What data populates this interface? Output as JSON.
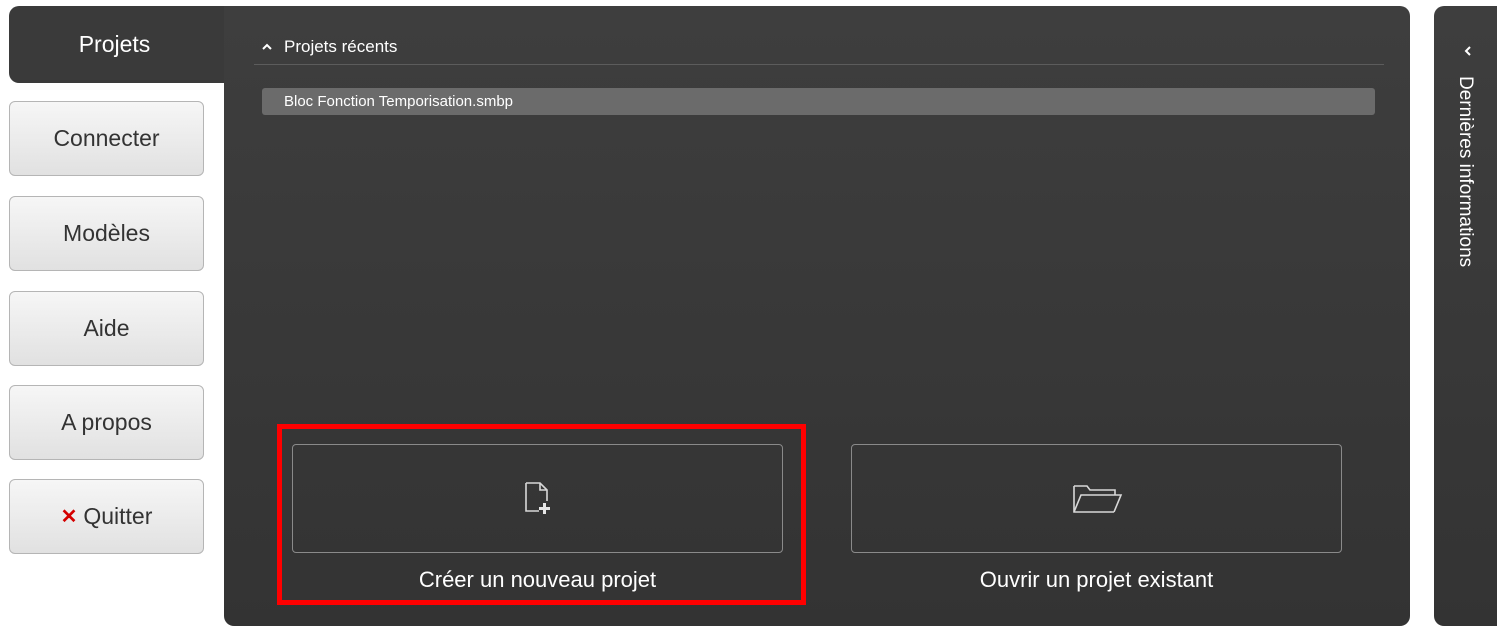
{
  "nav": {
    "active_tab": "Projets",
    "items": [
      {
        "label": "Connecter"
      },
      {
        "label": "Modèles"
      },
      {
        "label": "Aide"
      },
      {
        "label": "A propos"
      },
      {
        "label": "Quitter"
      }
    ]
  },
  "recent": {
    "header": "Projets récents",
    "items": [
      "Bloc Fonction Temporisation.smbp"
    ]
  },
  "actions": {
    "new_project": "Créer un nouveau projet",
    "open_project": "Ouvrir un projet existant"
  },
  "side_panel": {
    "title": "Dernières informations"
  },
  "colors": {
    "panel": "#3a3a3a",
    "highlight": "#ff0000",
    "quit_icon": "#d40000"
  }
}
